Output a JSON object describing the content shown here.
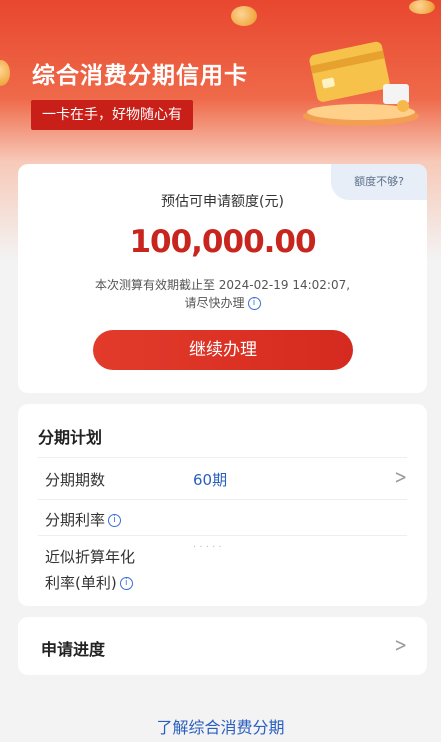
{
  "hero": {
    "title": "综合消费分期信用卡",
    "slogan": "一卡在手，好物随心有"
  },
  "quota": {
    "help_tag": "额度不够?",
    "label": "预估可申请额度(元)",
    "amount": "100,000.00",
    "valid_line1": "本次测算有效期截止至 2024-02-19 14:02:07,",
    "valid_line2": "请尽快办理",
    "continue_button": "继续办理"
  },
  "plan": {
    "title": "分期计划",
    "rows": [
      {
        "label": "分期期数",
        "value": "60期"
      },
      {
        "label": "分期利率",
        "value": ""
      },
      {
        "label_line1": "近似折算年化",
        "label_line2": "利率(单利)",
        "value": "· · · · ·"
      }
    ]
  },
  "progress": {
    "label": "申请进度"
  },
  "footer": {
    "learn_more": "了解综合消费分期"
  },
  "colors": {
    "brand_red": "#c8251e",
    "link_blue": "#2a5fbf"
  },
  "icons": [
    "info-icon",
    "chevron-right-icon",
    "credit-card-illustration",
    "coin-decoration"
  ]
}
